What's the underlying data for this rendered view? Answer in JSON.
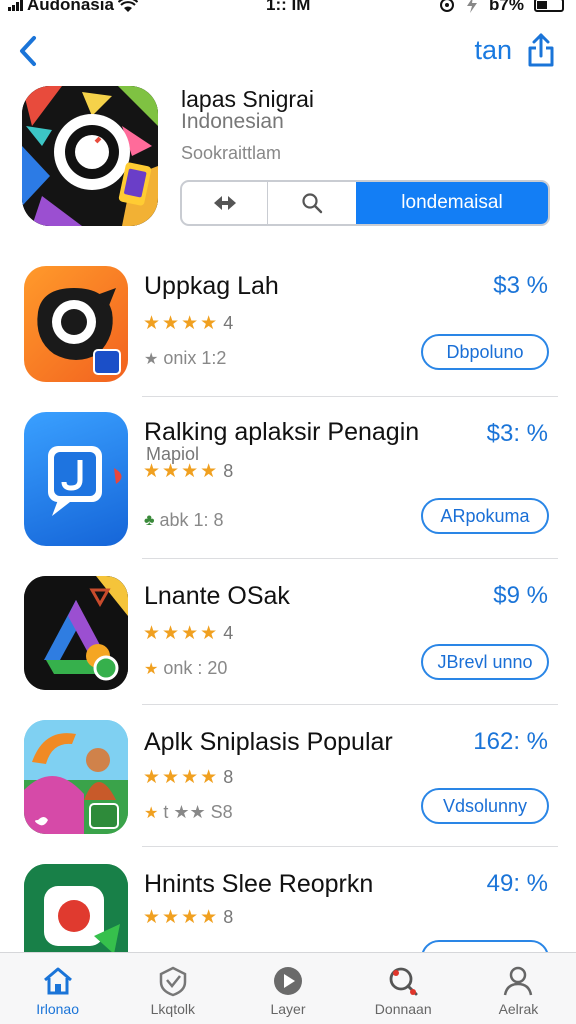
{
  "status_bar": {
    "carrier": "Audonasia",
    "time": "1:: IM",
    "battery": "b7%"
  },
  "nav": {
    "right_link": "tan"
  },
  "header": {
    "title": "lapas Snigrai",
    "subtitle": "Indonesian",
    "category": "Sookraittlam",
    "segment_active_label": "londemaisal"
  },
  "apps": [
    {
      "name": "Uppkag Lah",
      "subtitle": "",
      "rating": 4,
      "rating_text": "4",
      "meta": "onix 1:2",
      "price": "$3 %",
      "button": "Dbpoluno"
    },
    {
      "name": "Ralking aplaksir Penagin",
      "subtitle": "Mapiol",
      "rating": 4,
      "rating_text": "8",
      "meta": "abk 1: 8",
      "price": "$3: %",
      "button": "ARpokuma"
    },
    {
      "name": "Lnante OSak",
      "subtitle": "",
      "rating": 4,
      "rating_text": "4",
      "meta": "onk : 20",
      "price": "$9 %",
      "button": "JBrevl unno"
    },
    {
      "name": "Aplk Sniplasis Popular",
      "subtitle": "",
      "rating": 4,
      "rating_text": "8",
      "meta": "t ★★ S8",
      "price": "162: %",
      "button": "Vdsolunny"
    },
    {
      "name": "Hnints Slee Reoprkn",
      "subtitle": "",
      "rating": 4,
      "rating_text": "8",
      "meta": "",
      "price": "49: %",
      "button": ""
    }
  ],
  "tabs": [
    {
      "label": "Irlonao",
      "icon": "home-icon",
      "active": true
    },
    {
      "label": "Lkqtolk",
      "icon": "shield-check-icon",
      "active": false
    },
    {
      "label": "Layer",
      "icon": "play-circle-icon",
      "active": false
    },
    {
      "label": "Donnaan",
      "icon": "search-badge-icon",
      "active": false
    },
    {
      "label": "Aelrak",
      "icon": "person-icon",
      "active": false
    }
  ],
  "colors": {
    "accent": "#137ef5",
    "link": "#1a74d8",
    "star": "#f0a020"
  }
}
